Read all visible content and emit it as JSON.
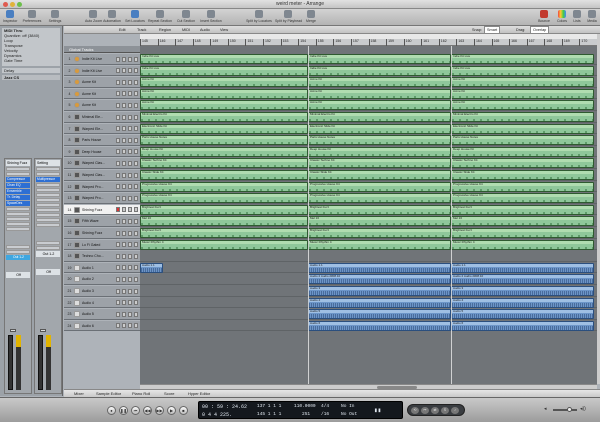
{
  "window": {
    "title": "weird meter - Arrange"
  },
  "toolbar": {
    "left": [
      {
        "label": "Inspector",
        "icon": "info-icon"
      },
      {
        "label": "Preferences",
        "icon": "switch-icon"
      },
      {
        "label": "Settings",
        "icon": "settings-icon"
      }
    ],
    "center": [
      {
        "label": "Auto Zoom",
        "icon": "zoom-icon"
      },
      {
        "label": "Automation",
        "icon": "automation-icon"
      },
      {
        "label": "Set Locators",
        "icon": "locator-icon"
      },
      {
        "label": "Repeat Section",
        "icon": "repeat-icon"
      },
      {
        "label": "Cut Section",
        "icon": "cut-icon"
      },
      {
        "label": "Insert Section",
        "icon": "insert-icon"
      },
      {
        "label": "Split by Locators",
        "icon": "split-icon"
      },
      {
        "label": "Split by Playhead",
        "icon": "split-playhead-icon"
      },
      {
        "label": "Merge",
        "icon": "merge-icon"
      }
    ],
    "right": [
      {
        "label": "Bounce",
        "icon": "bounce-icon"
      },
      {
        "label": "Colors",
        "icon": "colors-icon"
      },
      {
        "label": "Lists",
        "icon": "lists-icon"
      },
      {
        "label": "Media",
        "icon": "media-icon"
      }
    ]
  },
  "inspector": {
    "region_title": "MIDI Thru",
    "params": [
      {
        "label": "Quantize",
        "value": "off (3840)"
      },
      {
        "label": "Loop",
        "value": ""
      },
      {
        "label": "Transpose",
        "value": ""
      },
      {
        "label": "Velocity",
        "value": ""
      },
      {
        "label": "Dynamics",
        "value": ""
      },
      {
        "label": "Gate Time",
        "value": ""
      },
      {
        "label": "Delay",
        "value": ""
      }
    ],
    "section2": "Jazz CS",
    "strip_left": {
      "name": "Shining Fuzz",
      "setting": "Setting",
      "eq": "EQ",
      "inserts": [
        "Compressor",
        "Chan EQ",
        "Ensemble",
        "Tr. Delay",
        "SpaceDes"
      ],
      "output": "Out 1-2",
      "mode": "Off"
    },
    "strip_right": {
      "name": "Setting",
      "inserts": [
        "Multipressor"
      ],
      "output": "Out 1-2",
      "mode": "Off"
    }
  },
  "header": {
    "menus": [
      "Edit",
      "Track",
      "Region",
      "MIDI",
      "Audio",
      "View"
    ],
    "snap_label": "Snap:",
    "snap_value": "Smart",
    "drag_label": "Drag:",
    "drag_value": "Overlap"
  },
  "ruler": {
    "bars": [
      "145",
      "146",
      "147",
      "148",
      "149",
      "150",
      "151",
      "152",
      "153",
      "154",
      "155",
      "156",
      "157",
      "158",
      "159",
      "160",
      "161",
      "162",
      "163",
      "164",
      "165",
      "166",
      "167",
      "168",
      "169",
      "170"
    ]
  },
  "global_tracks": "Global Tracks",
  "tracks": [
    {
      "num": "1",
      "name": "Indie Kit Live",
      "type": "kit",
      "selected": false
    },
    {
      "num": "2",
      "name": "Indie Kit Live",
      "type": "kit",
      "selected": false
    },
    {
      "num": "3",
      "name": "Acme Kit",
      "type": "kit",
      "selected": false
    },
    {
      "num": "4",
      "name": "Acme Kit",
      "type": "kit",
      "selected": false
    },
    {
      "num": "5",
      "name": "Acme Kit",
      "type": "kit",
      "selected": false
    },
    {
      "num": "6",
      "name": "Minimal Ele...",
      "type": "synth",
      "selected": false
    },
    {
      "num": "7",
      "name": "Warped Ele...",
      "type": "synth",
      "selected": false
    },
    {
      "num": "8",
      "name": "Paris House",
      "type": "synth",
      "selected": false
    },
    {
      "num": "9",
      "name": "Deep House",
      "type": "synth",
      "selected": false
    },
    {
      "num": "10",
      "name": "Warped Clas...",
      "type": "synth",
      "selected": false
    },
    {
      "num": "11",
      "name": "Warped Clas...",
      "type": "synth",
      "selected": false
    },
    {
      "num": "12",
      "name": "Warped Pro...",
      "type": "synth",
      "selected": false
    },
    {
      "num": "13",
      "name": "Warped Pro...",
      "type": "synth",
      "selected": false
    },
    {
      "num": "14",
      "name": "Shining Fuzz",
      "type": "synth",
      "selected": true
    },
    {
      "num": "15",
      "name": "Fifth Wave",
      "type": "synth",
      "selected": false
    },
    {
      "num": "16",
      "name": "Shining Fuzz",
      "type": "synth",
      "selected": false
    },
    {
      "num": "17",
      "name": "Lo Fi Gated",
      "type": "synth",
      "selected": false
    },
    {
      "num": "18",
      "name": "Techno Cho...",
      "type": "synth",
      "selected": false
    },
    {
      "num": "19",
      "name": "Audio 1",
      "type": "audio",
      "selected": false
    },
    {
      "num": "20",
      "name": "Audio 2",
      "type": "audio",
      "selected": false
    },
    {
      "num": "21",
      "name": "Audio 3",
      "type": "audio",
      "selected": false
    },
    {
      "num": "22",
      "name": "Audio 4",
      "type": "audio",
      "selected": false
    },
    {
      "num": "23",
      "name": "Audio 5",
      "type": "audio",
      "selected": false
    },
    {
      "num": "24",
      "name": "Audio 6",
      "type": "audio",
      "selected": false
    }
  ],
  "regions": [
    {
      "label": "Indie Kit Live",
      "kind": "midi"
    },
    {
      "label": "Indie Kit Live",
      "kind": "midi"
    },
    {
      "label": "Acme Kit",
      "kind": "midi"
    },
    {
      "label": "Acme Kit",
      "kind": "midi"
    },
    {
      "label": "Acme Kit",
      "kind": "midi"
    },
    {
      "label": "Minimal Electro Kit",
      "kind": "midi"
    },
    {
      "label": "Electronic Slide Kit",
      "kind": "midi"
    },
    {
      "label": "Paris House Notes",
      "kind": "midi"
    },
    {
      "label": "Deep House Kit",
      "kind": "midi"
    },
    {
      "label": "Classic Techno Kit",
      "kind": "midi"
    },
    {
      "label": "Classic Slide Kit",
      "kind": "midi"
    },
    {
      "label": "Progressive House Kit",
      "kind": "midi"
    },
    {
      "label": "Progressive House Kit",
      "kind": "midi"
    },
    {
      "label": "Brightest Fuzz",
      "kind": "midi"
    },
    {
      "label": "Mel 16",
      "kind": "midi"
    },
    {
      "label": "Brightest Fuzz",
      "kind": "midi"
    },
    {
      "label": "Music Rhythm 4",
      "kind": "midi"
    },
    {
      "label": "",
      "kind": "none"
    },
    {
      "label": "Audio 1.1",
      "kind": "audio"
    },
    {
      "label": "Audio 2 Audio 2#08.10",
      "kind": "audio"
    },
    {
      "label": "Audio 3",
      "kind": "audio"
    },
    {
      "label": "Audio 4",
      "kind": "audio"
    },
    {
      "label": "Audio 5",
      "kind": "audio"
    },
    {
      "label": "Audio 6",
      "kind": "audio"
    }
  ],
  "bottom_tabs": [
    "Mixer",
    "Sample Editor",
    "Piano Roll",
    "Score",
    "Hyper Editor"
  ],
  "transport": {
    "position_smpte": "00 : 59 : 24.62",
    "position_bars": "0   4   4   225.",
    "locator_1": "137   1   1   1",
    "locator_2": "145   1   1   1",
    "tempo": "110.0000",
    "tempo_2": "251",
    "signature": "4/4",
    "division": "/16",
    "in_label": "No In",
    "out_label": "No Out"
  }
}
